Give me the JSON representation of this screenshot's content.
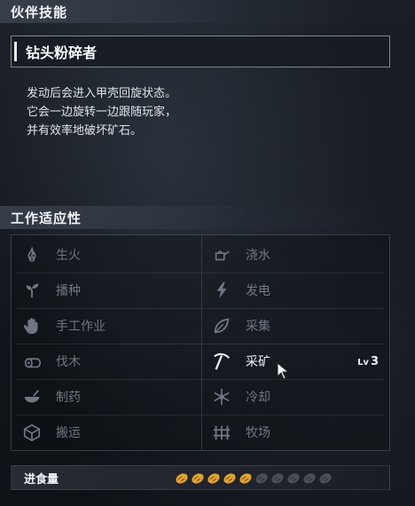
{
  "partner_skill": {
    "header": "伙伴技能",
    "name": "钻头粉碎者",
    "description": [
      "发动后会进入甲壳回旋状态。",
      "它会一边旋转一边跟随玩家，",
      "并有效率地破坏矿石。"
    ]
  },
  "work_suitability": {
    "header": "工作适应性",
    "items": [
      {
        "label": "生火",
        "icon": "flame-icon",
        "active": false
      },
      {
        "label": "浇水",
        "icon": "watering-can-icon",
        "active": false
      },
      {
        "label": "播种",
        "icon": "sprout-icon",
        "active": false
      },
      {
        "label": "发电",
        "icon": "lightning-icon",
        "active": false
      },
      {
        "label": "手工作业",
        "icon": "hand-icon",
        "active": false
      },
      {
        "label": "采集",
        "icon": "leaf-icon",
        "active": false
      },
      {
        "label": "伐木",
        "icon": "log-icon",
        "active": false
      },
      {
        "label": "采矿",
        "icon": "pickaxe-icon",
        "active": true,
        "level_prefix": "Lv",
        "level": "3"
      },
      {
        "label": "制药",
        "icon": "medicine-bowl-icon",
        "active": false
      },
      {
        "label": "冷却",
        "icon": "snowflake-icon",
        "active": false
      },
      {
        "label": "搬运",
        "icon": "box-icon",
        "active": false
      },
      {
        "label": "牧场",
        "icon": "fence-icon",
        "active": false
      }
    ]
  },
  "food": {
    "label": "进食量",
    "filled": 5,
    "total": 10
  },
  "colors": {
    "active_text": "#eef2f6",
    "inactive_text": "#6f7782",
    "food_filled": "#e0a238",
    "food_empty": "#4a4f57"
  }
}
